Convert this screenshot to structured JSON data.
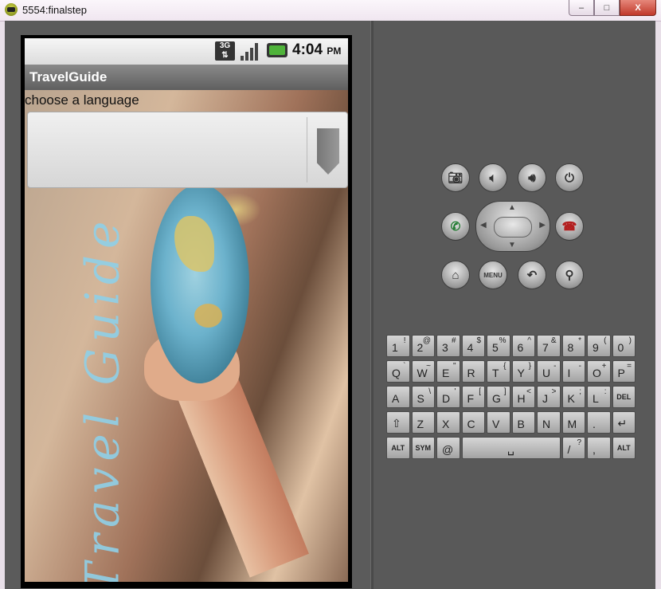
{
  "window": {
    "title": "5554:finalstep",
    "minimize_label": "–",
    "maximize_label": "□",
    "close_label": "X"
  },
  "status_bar": {
    "network": "3G",
    "time": "4:04",
    "ampm": "PM"
  },
  "app": {
    "title": "TravelGuide",
    "prompt": "choose a language",
    "spinner_value": "",
    "watermark": "Travel Guide"
  },
  "hardware": {
    "camera": "camera-icon",
    "vol_down": "volume-down-icon",
    "vol_up": "volume-up-icon",
    "power": "power-icon",
    "call": "call-icon",
    "end_call": "end-call-icon",
    "home": "home-icon",
    "menu_label": "MENU",
    "back": "back-icon",
    "search": "search-icon"
  },
  "keyboard": {
    "row1": [
      {
        "k": "1",
        "s": "!"
      },
      {
        "k": "2",
        "s": "@"
      },
      {
        "k": "3",
        "s": "#"
      },
      {
        "k": "4",
        "s": "$"
      },
      {
        "k": "5",
        "s": "%"
      },
      {
        "k": "6",
        "s": "^"
      },
      {
        "k": "7",
        "s": "&"
      },
      {
        "k": "8",
        "s": "*"
      },
      {
        "k": "9",
        "s": "("
      },
      {
        "k": "0",
        "s": ")"
      }
    ],
    "row2": [
      {
        "k": "Q",
        "s": "`"
      },
      {
        "k": "W",
        "s": "~"
      },
      {
        "k": "E",
        "s": "\""
      },
      {
        "k": "R",
        "s": ""
      },
      {
        "k": "T",
        "s": "{"
      },
      {
        "k": "Y",
        "s": "}"
      },
      {
        "k": "U",
        "s": "-"
      },
      {
        "k": "I",
        "s": "-"
      },
      {
        "k": "O",
        "s": "+"
      },
      {
        "k": "P",
        "s": "="
      }
    ],
    "row3": [
      {
        "k": "A",
        "s": ""
      },
      {
        "k": "S",
        "s": "\\"
      },
      {
        "k": "D",
        "s": "'"
      },
      {
        "k": "F",
        "s": "["
      },
      {
        "k": "G",
        "s": "]"
      },
      {
        "k": "H",
        "s": "<"
      },
      {
        "k": "J",
        "s": ">"
      },
      {
        "k": "K",
        "s": ";"
      },
      {
        "k": "L",
        "s": ":"
      },
      {
        "k": "DEL",
        "s": ""
      }
    ],
    "row4": [
      {
        "k": "⇧",
        "s": ""
      },
      {
        "k": "Z",
        "s": ""
      },
      {
        "k": "X",
        "s": ""
      },
      {
        "k": "C",
        "s": ""
      },
      {
        "k": "V",
        "s": ""
      },
      {
        "k": "B",
        "s": ""
      },
      {
        "k": "N",
        "s": ""
      },
      {
        "k": "M",
        "s": ""
      },
      {
        "k": ".",
        "s": ""
      },
      {
        "k": "↵",
        "s": ""
      }
    ],
    "row5": {
      "alt_left": "ALT",
      "sym": "SYM",
      "at": "@",
      "space": "␣",
      "slash": "/",
      "question": "?",
      "comma": ",",
      "alt_right": "ALT"
    }
  }
}
